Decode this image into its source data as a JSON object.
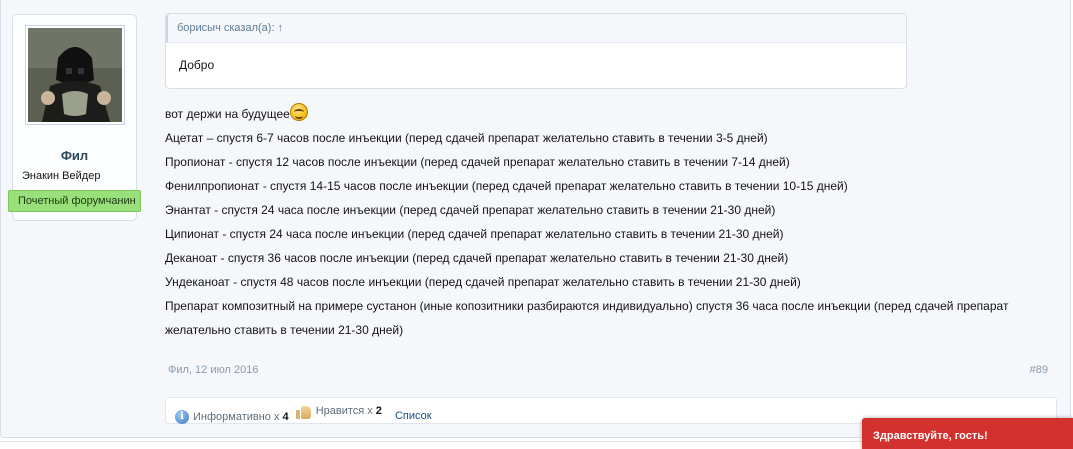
{
  "user": {
    "name": "Фил",
    "title": "Энакин Вейдер",
    "banner": "Почетный форумчанин"
  },
  "quote": {
    "header": "борисыч сказал(а): ↑",
    "text": "Добро"
  },
  "message": {
    "intro": "вот держи на будущее",
    "lines": [
      "Ацетат – спустя 6-7 часов после инъекции (перед сдачей препарат желательно ставить в течении 3-5 дней)",
      "Пропионат - спустя 12 часов после инъекции (перед сдачей препарат желательно ставить в течении 7-14 дней)",
      "Фенилпропионат - спустя 14-15 часов после инъекции (перед сдачей препарат желательно ставить в течении 10-15 дней)",
      "Энантат - спустя 24 часа после инъекции (перед сдачей препарат желательно ставить в течении 21-30 дней)",
      "Ципионат - спустя 24 часа после инъекции (перед сдачей препарат желательно ставить в течении 21-30 дней)",
      "Деканоат - спустя 36 часов после инъекции (перед сдачей препарат желательно ставить в течении 21-30 дней)",
      "Ундеканоат - спустя 48 часов после инъекции (перед сдачей препарат желательно ставить в течении 21-30 дней)",
      "Препарат композитный на примере сустанон (иные копозитники разбираются индивидуально) спустя 36 часа после инъекции (перед сдачей препарат желательно ставить в течении 21-30 дней)"
    ]
  },
  "meta": {
    "author_date": "Фил, 12 июл 2016",
    "post_number": "#89"
  },
  "likes": {
    "informative_label": "Информативно",
    "informative_mult": "x",
    "informative_count": "4",
    "like_label": "Нравится",
    "like_mult": "x",
    "like_count": "2",
    "list_label": "Список"
  },
  "notice": {
    "text": "Здравствуйте, гость!"
  },
  "colors": {
    "banner_green": "#9ae07a",
    "username_blue": "#2b485c",
    "notice_red": "#d2312d"
  }
}
